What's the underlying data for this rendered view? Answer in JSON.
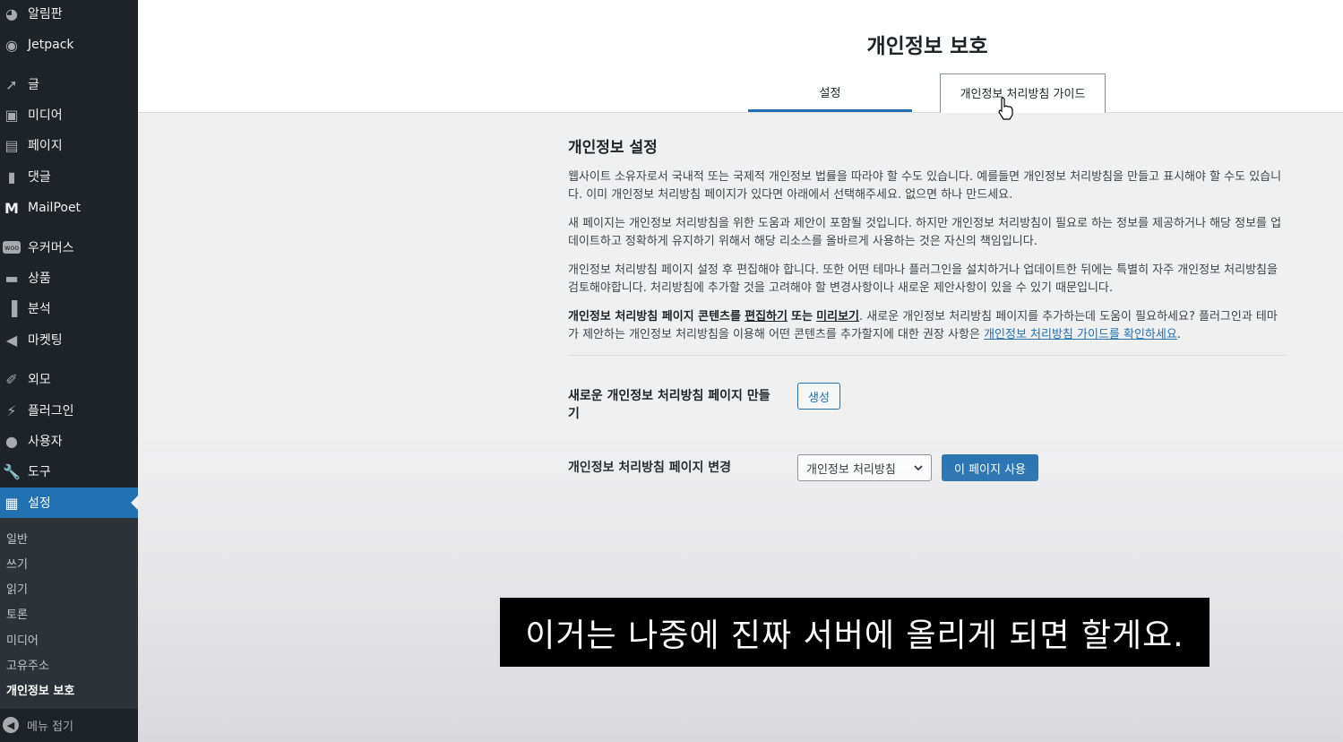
{
  "sidebar": {
    "items": [
      {
        "label": "알림판",
        "icon": "dashboard-icon"
      },
      {
        "label": "Jetpack",
        "icon": "jetpack-icon"
      },
      {
        "label": "글",
        "icon": "pin-icon"
      },
      {
        "label": "미디어",
        "icon": "media-icon"
      },
      {
        "label": "페이지",
        "icon": "page-icon"
      },
      {
        "label": "댓글",
        "icon": "comment-icon"
      },
      {
        "label": "MailPoet",
        "icon": "mailpoet-icon"
      },
      {
        "label": "우커머스",
        "icon": "woo-icon"
      },
      {
        "label": "상품",
        "icon": "archive-icon"
      },
      {
        "label": "분석",
        "icon": "chart-icon"
      },
      {
        "label": "마켓팅",
        "icon": "megaphone-icon"
      },
      {
        "label": "외모",
        "icon": "brush-icon"
      },
      {
        "label": "플러그인",
        "icon": "plugin-icon"
      },
      {
        "label": "사용자",
        "icon": "user-icon"
      },
      {
        "label": "도구",
        "icon": "wrench-icon"
      },
      {
        "label": "설정",
        "icon": "settings-icon"
      }
    ],
    "submenu": [
      "일반",
      "쓰기",
      "읽기",
      "토론",
      "미디어",
      "고유주소",
      "개인정보 보호"
    ],
    "collapse_label": "메뉴 접기"
  },
  "header": {
    "title": "개인정보 보호",
    "tabs": [
      "설정",
      "개인정보 처리방침 가이드"
    ]
  },
  "main": {
    "section_title": "개인정보 설정",
    "paragraphs": [
      "웹사이트 소유자로서 국내적 또는 국제적 개인정보 법률을 따라야 할 수도 있습니다. 예를들면 개인정보 처리방침을 만들고 표시해야 할 수도 있습니다. 이미 개인정보 처리방침 페이지가 있다면 아래에서 선택해주세요. 없으면 하나 만드세요.",
      "새 페이지는 개인정보 처리방침을 위한 도움과 제안이 포함될 것입니다. 하지만 개인정보 처리방침이 필요로 하는 정보를 제공하거나 해당 정보를 업데이트하고 정확하게 유지하기 위해서 해당 리소스를 올바르게 사용하는 것은 자신의 책임입니다.",
      "개인정보 처리방침 페이지 설정 후 편집해야 합니다. 또한 어떤 테마나 플러그인을 설치하거나 업데이트한 뒤에는 특별히 자주 개인정보 처리방침을 검토해야합니다. 처리방침에 추가할 것을 고려해야 할 변경사항이나 새로운 제안사항이 있을 수 있기 때문입니다."
    ],
    "p4_bold": "개인정보 처리방침 페이지 콘텐츠를",
    "p4_edit_link": "편집하기",
    "p4_or": "또는",
    "p4_preview_link": "미리보기",
    "p4_text": ". 새로운 개인정보 처리방침 페이지를 추가하는데 도움이 필요하세요? 플러그인과 테마가 제안하는 개인정보 처리방침을 이용해 어떤 콘텐츠를 추가할지에 대한 권장 사항은",
    "p4_guide_link": "개인정보 처리방침 가이드를 확인하세요",
    "p4_end": ".",
    "create_label": "새로운 개인정보 처리방침 페이지 만들기",
    "create_button": "생성",
    "change_label": "개인정보 처리방침 페이지 변경",
    "selected_page": "개인정보 처리방침",
    "use_button": "이 페이지 사용"
  },
  "subtitle": "이거는 나중에 진짜 서버에 올리게 되면 할게요.",
  "colors": {
    "sidebar_bg": "#1d2327",
    "active_bg": "#2271b1",
    "link": "#2271b1"
  }
}
